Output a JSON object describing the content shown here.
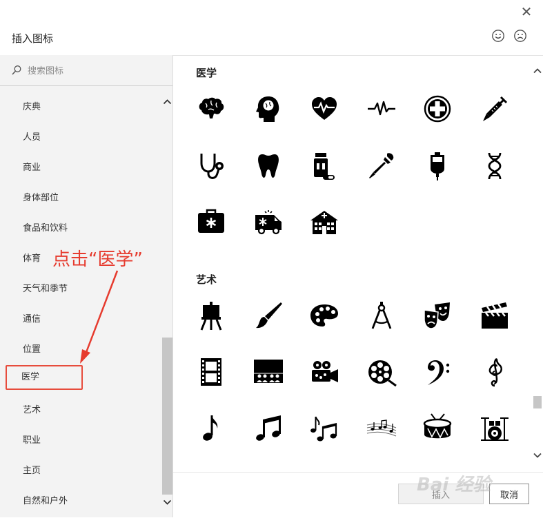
{
  "dialog": {
    "title": "插入图标",
    "close_glyph": "✕",
    "feedback": {
      "happy": "smile-icon",
      "sad": "frown-icon"
    }
  },
  "search": {
    "placeholder": "搜索图标",
    "value": ""
  },
  "sidebar": {
    "categories": [
      {
        "label": "庆典"
      },
      {
        "label": "人员"
      },
      {
        "label": "商业"
      },
      {
        "label": "身体部位"
      },
      {
        "label": "食品和饮料"
      },
      {
        "label": "体育"
      },
      {
        "label": "天气和季节"
      },
      {
        "label": "通信"
      },
      {
        "label": "位置"
      },
      {
        "label": "医学",
        "selected": true
      },
      {
        "label": "艺术"
      },
      {
        "label": "职业"
      },
      {
        "label": "主页"
      },
      {
        "label": "自然和户外"
      }
    ]
  },
  "sections": {
    "medical": {
      "title": "医学",
      "icons": [
        "brain-icon",
        "head-brain-icon",
        "heart-pulse-icon",
        "pulse-line-icon",
        "medical-cross-icon",
        "syringe-icon",
        "stethoscope-icon",
        "tooth-icon",
        "pill-bottle-icon",
        "dropper-icon",
        "iv-bag-icon",
        "dna-icon",
        "first-aid-kit-icon",
        "ambulance-icon",
        "hospital-icon"
      ]
    },
    "art": {
      "title": "艺术",
      "icons": [
        "easel-icon",
        "paintbrush-icon",
        "palette-icon",
        "compass-tool-icon",
        "theater-masks-icon",
        "clapperboard-icon",
        "film-strip-icon",
        "cinema-audience-icon",
        "film-camera-icon",
        "film-reel-icon",
        "bass-clef-icon",
        "treble-clef-icon",
        "eighth-note-icon",
        "beamed-notes-icon",
        "music-notes-icon",
        "sheet-music-icon",
        "drum-icon",
        "drum-kit-icon"
      ]
    }
  },
  "footer": {
    "insert_label": "插入",
    "cancel_label": "取消"
  },
  "annotation": {
    "text": "点击“医学”",
    "color": "#e63b2e"
  },
  "watermark": {
    "text": "Bai 经验"
  },
  "colors": {
    "accent_red": "#e63b2e",
    "icon": "#000000"
  }
}
